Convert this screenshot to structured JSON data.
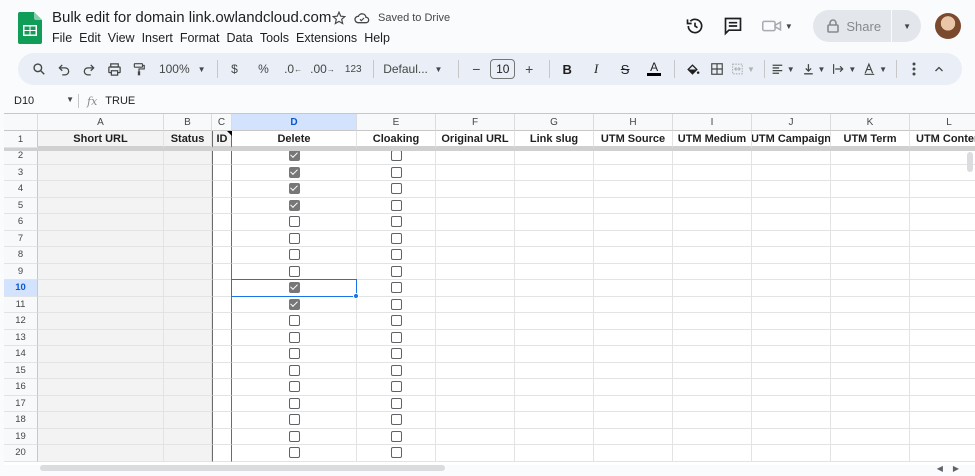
{
  "doc": {
    "title": "Bulk edit for domain link.owlandcloud.com",
    "save_status": "Saved to Drive"
  },
  "menu": [
    "File",
    "Edit",
    "View",
    "Insert",
    "Format",
    "Data",
    "Tools",
    "Extensions",
    "Help"
  ],
  "share_label": "Share",
  "toolbar": {
    "zoom": "100%",
    "currency": "$",
    "percent": "%",
    "dec_decrease": ".0",
    "dec_increase": ".00",
    "number_format": "123",
    "font": "Defaul...",
    "font_size": "10",
    "minus": "−",
    "plus": "+",
    "bold": "B",
    "italic": "I",
    "strike": "S",
    "text_color_label": "A",
    "text_color": "#000000"
  },
  "formula_bar": {
    "cell_ref": "D10",
    "fx": "fx",
    "value": "TRUE"
  },
  "columns": [
    {
      "letter": "A",
      "header": "Short URL",
      "width": 126
    },
    {
      "letter": "B",
      "header": "Status",
      "width": 48
    },
    {
      "letter": "C",
      "header": "ID",
      "width": 20
    },
    {
      "letter": "D",
      "header": "Delete",
      "width": 125
    },
    {
      "letter": "E",
      "header": "Cloaking",
      "width": 79
    },
    {
      "letter": "F",
      "header": "Original URL",
      "width": 79
    },
    {
      "letter": "G",
      "header": "Link slug",
      "width": 79
    },
    {
      "letter": "H",
      "header": "UTM Source",
      "width": 79
    },
    {
      "letter": "I",
      "header": "UTM Medium",
      "width": 79
    },
    {
      "letter": "J",
      "header": "UTM Campaign",
      "width": 79
    },
    {
      "letter": "K",
      "header": "UTM Term",
      "width": 79
    },
    {
      "letter": "L",
      "header": "UTM Content",
      "width": 79
    }
  ],
  "rows": [
    {
      "num": "2",
      "delete": true,
      "cloaking": false
    },
    {
      "num": "3",
      "delete": true,
      "cloaking": false
    },
    {
      "num": "4",
      "delete": true,
      "cloaking": false
    },
    {
      "num": "5",
      "delete": true,
      "cloaking": false
    },
    {
      "num": "6",
      "delete": false,
      "cloaking": false
    },
    {
      "num": "7",
      "delete": false,
      "cloaking": false
    },
    {
      "num": "8",
      "delete": false,
      "cloaking": false
    },
    {
      "num": "9",
      "delete": false,
      "cloaking": false
    },
    {
      "num": "10",
      "delete": true,
      "cloaking": false
    },
    {
      "num": "11",
      "delete": true,
      "cloaking": false
    },
    {
      "num": "12",
      "delete": false,
      "cloaking": false
    },
    {
      "num": "13",
      "delete": false,
      "cloaking": false
    },
    {
      "num": "14",
      "delete": false,
      "cloaking": false
    },
    {
      "num": "15",
      "delete": false,
      "cloaking": false
    },
    {
      "num": "16",
      "delete": false,
      "cloaking": false
    },
    {
      "num": "17",
      "delete": false,
      "cloaking": false
    },
    {
      "num": "18",
      "delete": false,
      "cloaking": false
    },
    {
      "num": "19",
      "delete": false,
      "cloaking": false
    },
    {
      "num": "20",
      "delete": false,
      "cloaking": false
    }
  ],
  "header_row_num": "1",
  "selected": {
    "column": "D",
    "row": "10"
  },
  "colors": {
    "sheets_green": "#0f9d58",
    "selection_blue": "#1a73e8",
    "checkbox_checked": "#777777"
  }
}
